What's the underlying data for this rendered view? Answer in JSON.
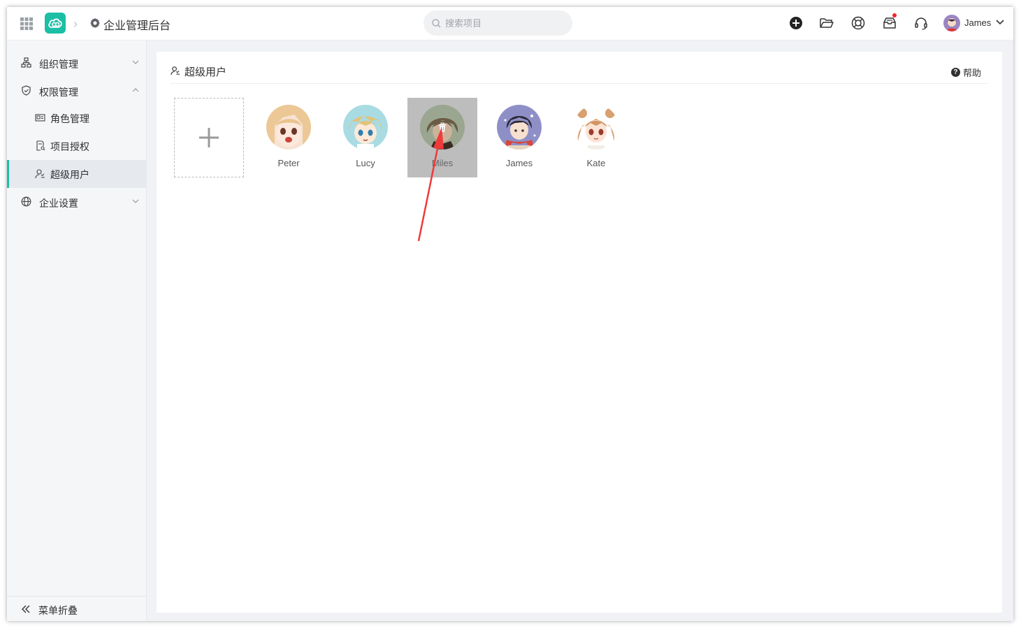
{
  "header": {
    "app_title": "企业管理后台",
    "search_placeholder": "搜索项目",
    "user_name": "James",
    "icons": [
      "apps-grid-icon",
      "cloud-logo-icon",
      "gear-icon",
      "search-icon",
      "add-circle-icon",
      "folder-open-icon",
      "support-icon",
      "inbox-icon",
      "headset-icon",
      "chevron-down-icon"
    ]
  },
  "sidebar": {
    "items": [
      {
        "label": "组织管理",
        "icon": "org-chart-icon",
        "expanded": false
      },
      {
        "label": "权限管理",
        "icon": "shield-icon",
        "expanded": true
      },
      {
        "label": "角色管理",
        "icon": "id-card-icon",
        "sub": true
      },
      {
        "label": "项目授权",
        "icon": "doc-key-icon",
        "sub": true
      },
      {
        "label": "超级用户",
        "icon": "super-user-icon",
        "sub": true,
        "active": true
      },
      {
        "label": "企业设置",
        "icon": "globe-icon",
        "expanded": false
      }
    ],
    "collapse_label": "菜单折叠"
  },
  "main": {
    "title": "超级用户",
    "help_label": "帮助",
    "add_symbol": "+",
    "users": [
      {
        "name": "Peter"
      },
      {
        "name": "Lucy"
      },
      {
        "name": "Miles",
        "hovered": true
      },
      {
        "name": "James"
      },
      {
        "name": "Kate"
      }
    ]
  },
  "colors": {
    "accent": "#1cbfa6",
    "hover_overlay": "#bdbdbd",
    "annotation_arrow": "#f03a3a",
    "notification_dot": "#f5222d"
  }
}
